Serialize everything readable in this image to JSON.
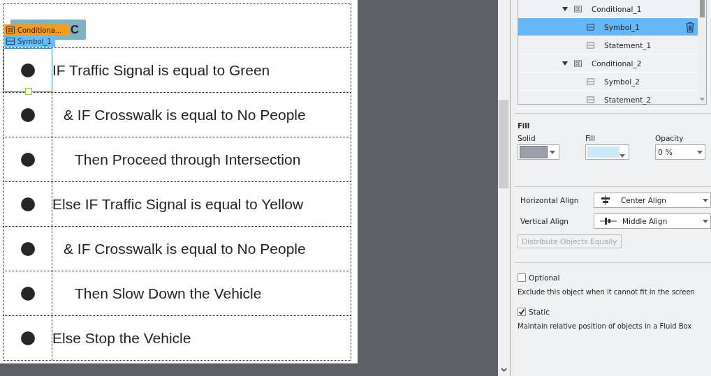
{
  "canvas": {
    "hidden_label": "C",
    "tags": [
      {
        "kind": "conditional",
        "label": "Conditiona..."
      },
      {
        "kind": "symbol",
        "label": "Symbol_1"
      }
    ],
    "rows": [
      {
        "kind": "if",
        "text": "IF Traffic Signal is equal to Green",
        "selected": true
      },
      {
        "kind": "and",
        "text": "& IF Crosswalk is equal to No People",
        "selected": false
      },
      {
        "kind": "then",
        "text": "Then Proceed through Intersection",
        "selected": false
      },
      {
        "kind": "if",
        "text": "Else IF Traffic Signal is equal to Yellow",
        "selected": false
      },
      {
        "kind": "and",
        "text": "& IF Crosswalk is equal to No People",
        "selected": false
      },
      {
        "kind": "then",
        "text": "Then Slow Down the Vehicle",
        "selected": false
      },
      {
        "kind": "if",
        "text": "Else Stop the Vehicle",
        "selected": false
      }
    ]
  },
  "tree": [
    {
      "kind": "conditional",
      "label": "Conditional_1",
      "expanded": true,
      "selected": false,
      "children": [
        {
          "kind": "symbol",
          "label": "Symbol_1",
          "selected": true
        },
        {
          "kind": "symbol",
          "label": "Statement_1",
          "selected": false
        }
      ]
    },
    {
      "kind": "conditional",
      "label": "Conditional_2",
      "expanded": true,
      "selected": false,
      "children": [
        {
          "kind": "symbol",
          "label": "Symbol_2",
          "selected": false
        },
        {
          "kind": "symbol",
          "label": "Statement_2",
          "selected": false
        }
      ]
    }
  ],
  "fill": {
    "title": "Fill",
    "solid_label": "Solid",
    "fill_label": "Fill",
    "opacity_label": "Opacity",
    "opacity_value": "0 %"
  },
  "align": {
    "horizontal_label": "Horizontal Align",
    "horizontal_value": "Center Align",
    "vertical_label": "Vertical Align",
    "vertical_value": "Middle Align",
    "distribute_button": "Distribute Objects Equally",
    "distribute_disabled": true
  },
  "options": [
    {
      "label": "Optional",
      "checked": false,
      "description": "Exclude this object when it cannot fit in the screen"
    },
    {
      "label": "Static",
      "checked": true,
      "description": "Maintain relative position of objects in a Fluid Box"
    }
  ]
}
